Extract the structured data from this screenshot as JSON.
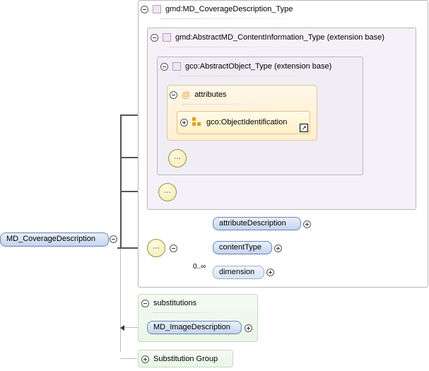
{
  "root": {
    "label": "MD_CoverageDescription"
  },
  "complex_type": {
    "label": "gmd:MD_CoverageDescription_Type"
  },
  "extension1": {
    "label": "gmd:AbstractMD_ContentInformation_Type (extension base)"
  },
  "extension2": {
    "label": "gco:AbstractObject_Type (extension base)"
  },
  "attributes": {
    "label": "attributes",
    "item_label": "gco:ObjectIdentification"
  },
  "sequence_elements": [
    {
      "label": "attributeDescription"
    },
    {
      "label": "contentType"
    },
    {
      "label": "dimension",
      "cardinality": "0..∞"
    }
  ],
  "substitutions": {
    "label": "substitutions",
    "item_label": "MD_ImageDescription"
  },
  "substitution_group": {
    "label": "Substitution Group"
  },
  "colors": {
    "element_fill": "#c5d5ee",
    "type_fill": "#f6f1f8",
    "attribute_fill": "#fff6e6",
    "substitution_fill": "#eaf5e6"
  }
}
